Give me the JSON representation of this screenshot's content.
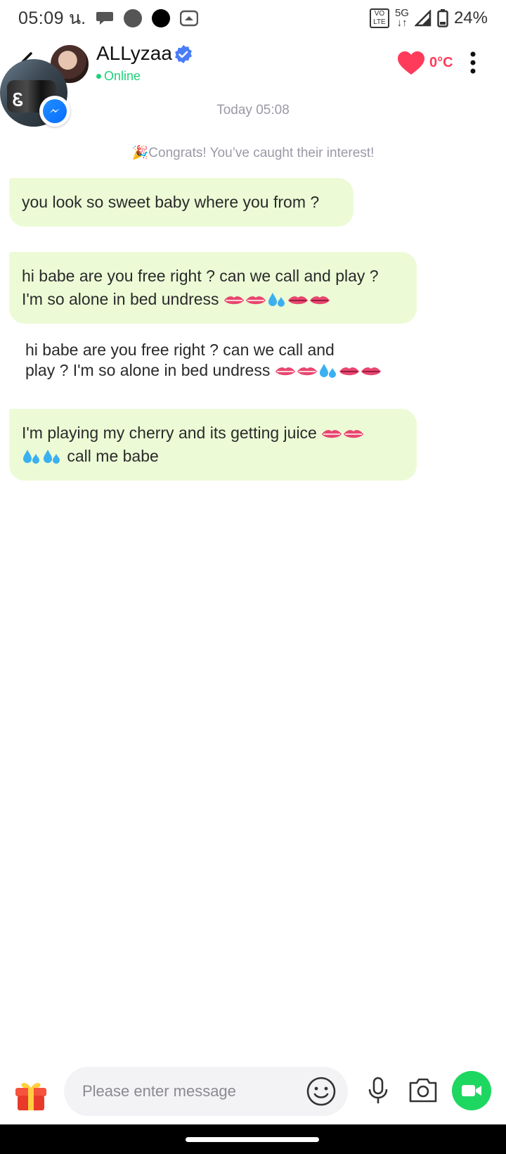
{
  "status_bar": {
    "time": "05:09",
    "suffix": "น.",
    "network": "5G",
    "volte": "VO LTE",
    "battery": "24%"
  },
  "header": {
    "name": "ALLyzaa",
    "status": "Online",
    "temperature": "0°C",
    "accent_color": "#ff3b5c",
    "online_color": "#1fd17a"
  },
  "chat": {
    "timestamp": "Today 05:08",
    "notice": "🎉Congrats! You’ve caught their interest!",
    "messages": [
      {
        "type": "bubble",
        "line1": "you look so sweet baby where you from ?"
      },
      {
        "type": "bubble",
        "line1": "hi babe are you free right ? can we call and play ?",
        "line2": "I'm so alone in bed undress"
      },
      {
        "type": "plain",
        "line1": "hi babe are you free right ? can we call and",
        "line2": "play ? I'm so alone in bed undress"
      },
      {
        "type": "bubble",
        "line1": "I'm playing my cherry and its getting juice",
        "line2": "call me babe"
      }
    ],
    "bubble_color": "#ecfbd6"
  },
  "composer": {
    "placeholder": "Please enter message",
    "value": ""
  }
}
